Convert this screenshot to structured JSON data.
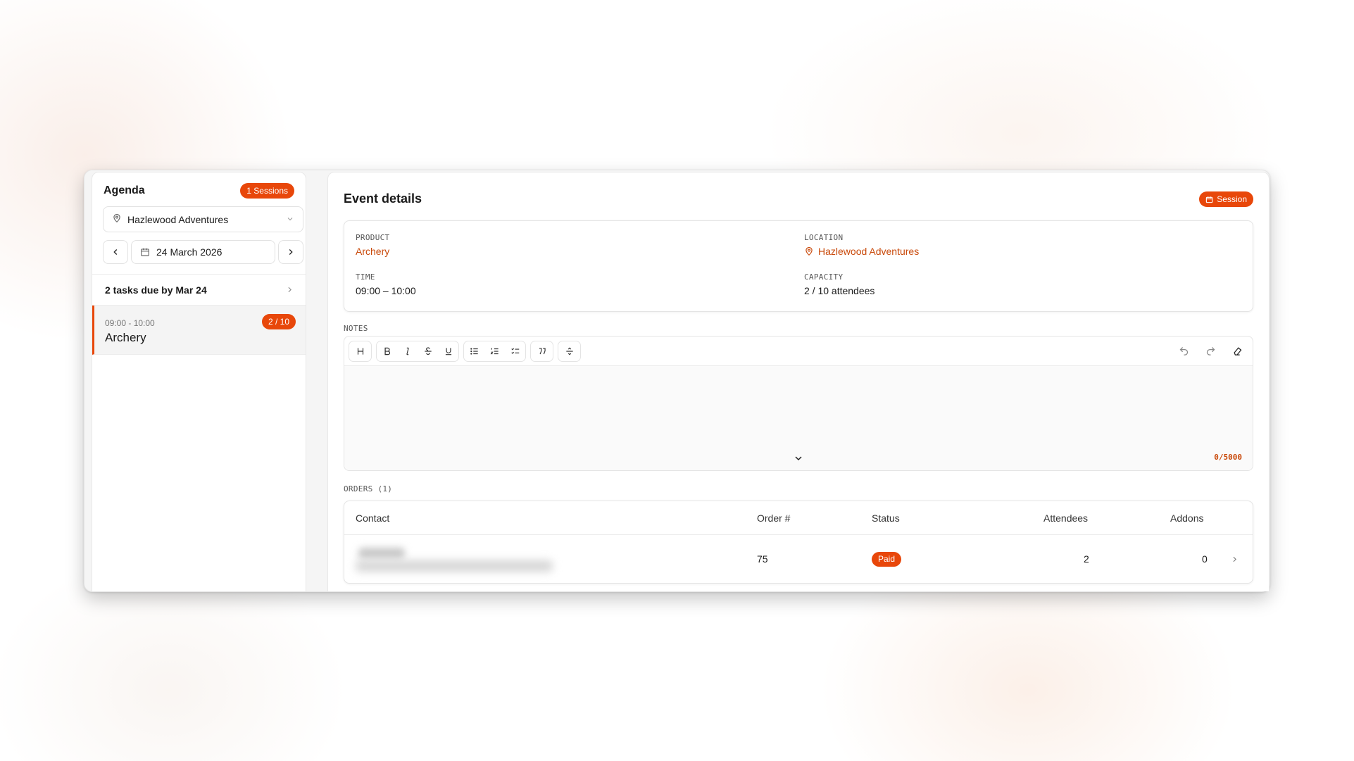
{
  "sidebar": {
    "title": "Agenda",
    "sessions_badge": "1 Sessions",
    "location": "Hazlewood Adventures",
    "date": "24 March 2026",
    "tasks_due": "2 tasks due by Mar 24",
    "sessions": [
      {
        "time": "09:00 - 10:00",
        "name": "Archery",
        "capacity": "2 / 10"
      }
    ]
  },
  "event": {
    "title": "Event details",
    "type_badge": "Session",
    "product_label": "PRODUCT",
    "product": "Archery",
    "location_label": "LOCATION",
    "location": "Hazlewood Adventures",
    "time_label": "TIME",
    "time": "09:00 – 10:00",
    "capacity_label": "CAPACITY",
    "capacity": "2 / 10 attendees"
  },
  "notes": {
    "label": "NOTES",
    "counter": "0/5000"
  },
  "orders": {
    "label": "ORDERS (1)",
    "columns": [
      "Contact",
      "Order #",
      "Status",
      "Attendees",
      "Addons"
    ],
    "rows": [
      {
        "order_no": "75",
        "status": "Paid",
        "attendees": "2",
        "addons": "0"
      }
    ]
  },
  "colors": {
    "accent": "#e8470a",
    "accent_text": "#c9490a"
  }
}
